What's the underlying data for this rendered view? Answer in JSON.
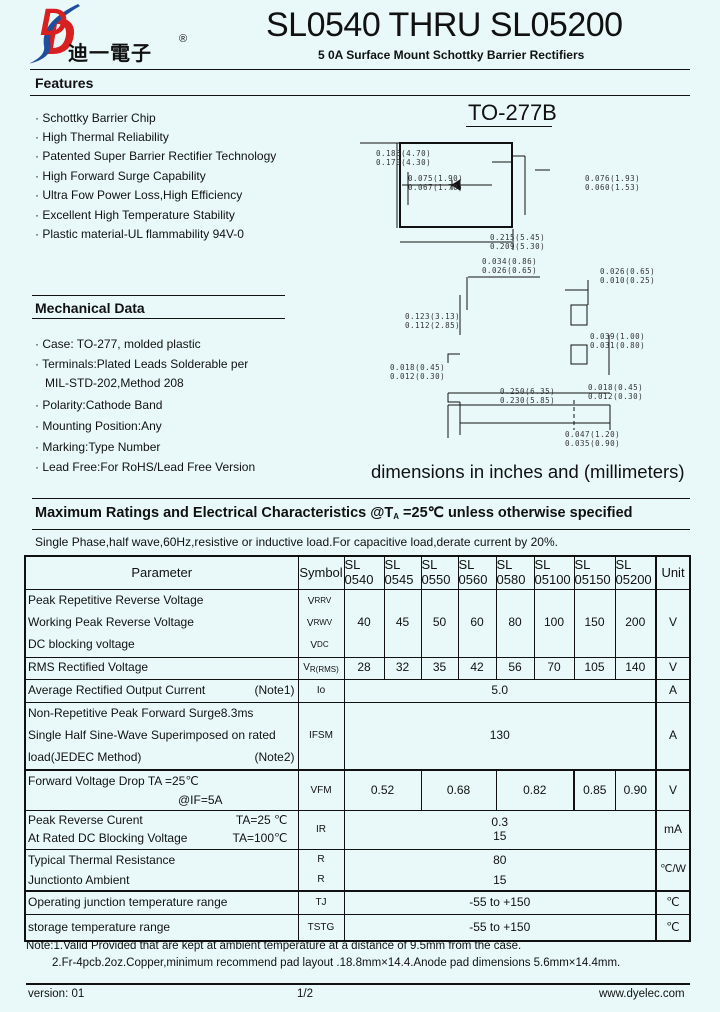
{
  "header": {
    "logo_letter": "D",
    "logo_cn": "迪一電子",
    "logo_reg": "®",
    "title": "SL0540 THRU SL05200",
    "subtitle": "5 0A Surface Mount Schottky Barrier Rectifiers"
  },
  "features": {
    "heading": "Features",
    "items": [
      "Schottky Barrier Chip",
      "High Thermal Reliability",
      "Patented Super Barrier Rectifier Technology",
      "High Forward Surge Capability",
      "Ultra Fow Power Loss,High Efficiency",
      "Excellent High Temperature Stability",
      "Plastic material-UL flammability 94V-0"
    ]
  },
  "mechanical": {
    "heading": "Mechanical Data",
    "items": [
      "Case: TO-277, molded plastic",
      "Terminals:Plated Leads Solderable per",
      "Polarity:Cathode Band",
      "Mounting Position:Any",
      "Marking:Type Number",
      "Lead Free:For RoHS/Lead Free Version"
    ],
    "continuation": "MIL-STD-202,Method 208"
  },
  "package": {
    "title": "TO-277B",
    "caption": "dimensions in inches and (millimeters)",
    "dims": [
      "0.185(4.70)",
      "0.170(4.30)",
      "0.075(1.90)",
      "0.067(1.70)",
      "0.076(1.93)",
      "0.060(1.53)",
      "0.215(5.45)",
      "0.209(5.30)",
      "0.034(0.86)",
      "0.026(0.65)",
      "0.026(0.65)",
      "0.010(0.25)",
      "0.123(3.13)",
      "0.112(2.85)",
      "0.039(1.00)",
      "0.031(0.80)",
      "0.018(0.45)",
      "0.012(0.30)",
      "0.250(6.35)",
      "0.230(5.85)",
      "0.018(0.45)",
      "0.012(0.30)",
      "0.047(1.20)",
      "0.035(0.90)"
    ]
  },
  "ratings": {
    "heading_pre": "Maximum Ratings and Electrical Characteristics @T",
    "heading_sub": "A",
    "heading_post": " =25℃ unless otherwise specified",
    "conditions": "Single Phase,half wave,60Hz,resistive or inductive load.For capacitive load,derate current by 20%."
  },
  "table": {
    "header": {
      "parameter": "Parameter",
      "symbol": "Symbol",
      "parts": [
        {
          "l1": "SL",
          "l2": "0540"
        },
        {
          "l1": "SL",
          "l2": "0545"
        },
        {
          "l1": "SL",
          "l2": "0550"
        },
        {
          "l1": "SL",
          "l2": "0560"
        },
        {
          "l1": "SL",
          "l2": "0580"
        },
        {
          "l1": "SL",
          "l2": "05100"
        },
        {
          "l1": "SL",
          "l2": "05150"
        },
        {
          "l1": "SL",
          "l2": "05200"
        }
      ],
      "unit": "Unit"
    },
    "vrrm": {
      "params": [
        "Peak Repetitive Reverse Voltage",
        "Working Peak Reverse Voltage",
        "DC blocking voltage"
      ],
      "symbols": [
        {
          "m": "V",
          "s": "RRV"
        },
        {
          "m": "V",
          "s": "RWV"
        },
        {
          "m": "V",
          "s": "DC"
        }
      ],
      "values": [
        "40",
        "45",
        "50",
        "60",
        "80",
        "100",
        "150",
        "200"
      ],
      "unit": "V"
    },
    "vrms": {
      "param": "RMS Rectified Voltage",
      "symbol": {
        "m": "V",
        "s": "R(RMS)"
      },
      "values": [
        "28",
        "32",
        "35",
        "42",
        "56",
        "70",
        "105",
        "140"
      ],
      "unit": "V"
    },
    "io": {
      "param": "Average Rectified Output Current",
      "note": "(Note1)",
      "symbol": "Io",
      "value": "5.0",
      "unit": "A"
    },
    "ifsm": {
      "params": [
        "Non-Repetitive Peak Forward Surge8.3ms",
        "Single Half Sine-Wave Superimposed on rated",
        "load(JEDEC Method)"
      ],
      "note": "(Note2)",
      "symbol": "IFSM",
      "value": "130",
      "unit": "A"
    },
    "vf": {
      "param": "Forward Voltage Drop  TA =25℃",
      "param2": "@IF=5A",
      "symbol": "VFM",
      "values": [
        "0.52",
        "0.68",
        "0.82",
        "0.85",
        "0.90"
      ],
      "unit": "V"
    },
    "ir": {
      "param": "Peak Reverse Curent",
      "cond1": "TA=25 ℃",
      "param2": "At Rated DC Blocking Voltage",
      "cond2": "TA=100℃",
      "symbol": "IR",
      "value1": "0.3",
      "value2": "15",
      "unit": "mA"
    },
    "rth": {
      "param": "Typical Thermal Resistance",
      "param2": "Junctionto Ambient",
      "symbol1": "R",
      "symbol2": "R",
      "value1": "80",
      "value2": "15",
      "unit": "℃/W"
    },
    "tj": {
      "param": "Operating junction temperature range",
      "symbol": "TJ",
      "value": "-55 to +150",
      "unit": "℃"
    },
    "tstg": {
      "param": "storage temperature range",
      "symbol": "TSTG",
      "value": "-55 to +150",
      "unit": "℃"
    }
  },
  "notes": [
    "Note:1.Valid Provided that are kept at ambient temperature at a distance of 9.5mm from the case.",
    "2.Fr-4pcb.2oz.Copper,minimum recommend pad layout .18.8mm×14.4.Anode pad dimensions 5.6mm×14.4mm."
  ],
  "footer": {
    "version": "version: 01",
    "page": "1/2",
    "website": "www.dyelec.com"
  }
}
